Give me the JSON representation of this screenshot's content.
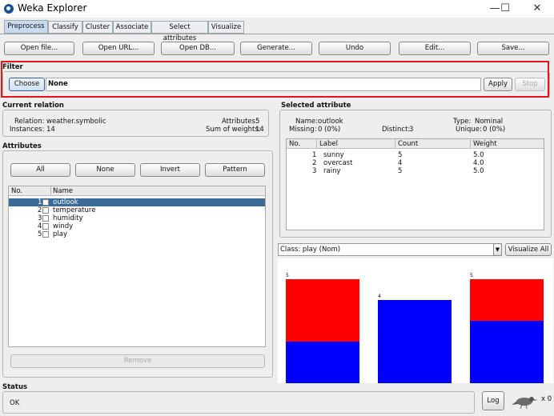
{
  "window": {
    "title": "Weka Explorer",
    "minimize_glyph": "—",
    "maximize_glyph": "☐",
    "close_glyph": "✕"
  },
  "tabs": [
    "Preprocess",
    "Classify",
    "Cluster",
    "Associate",
    "Select attributes",
    "Visualize"
  ],
  "toolbar": {
    "open_file": "Open file...",
    "open_url": "Open URL...",
    "open_db": "Open DB...",
    "generate": "Generate...",
    "undo": "Undo",
    "edit": "Edit...",
    "save": "Save..."
  },
  "filter": {
    "section_label": "Filter",
    "choose_label": "Choose",
    "value": "None",
    "apply_label": "Apply",
    "stop_label": "Stop"
  },
  "current_relation": {
    "section_label": "Current relation",
    "relation_label": "Relation:",
    "relation_value": "weather.symbolic",
    "instances_label": "Instances:",
    "instances_value": "14",
    "attributes_label": "Attributes:",
    "attributes_value": "5",
    "weights_label": "Sum of weights:",
    "weights_value": "14"
  },
  "attributes": {
    "section_label": "Attributes",
    "buttons": {
      "all": "All",
      "none": "None",
      "invert": "Invert",
      "pattern": "Pattern"
    },
    "col_no": "No.",
    "col_name": "Name",
    "rows": [
      {
        "no": "1",
        "name": "outlook"
      },
      {
        "no": "2",
        "name": "temperature"
      },
      {
        "no": "3",
        "name": "humidity"
      },
      {
        "no": "4",
        "name": "windy"
      },
      {
        "no": "5",
        "name": "play"
      }
    ],
    "remove_label": "Remove"
  },
  "selected_attribute": {
    "section_label": "Selected attribute",
    "name_label": "Name:",
    "name_value": "outlook",
    "type_label": "Type:",
    "type_value": "Nominal",
    "missing_label": "Missing:",
    "missing_value": "0 (0%)",
    "distinct_label": "Distinct:",
    "distinct_value": "3",
    "unique_label": "Unique:",
    "unique_value": "0 (0%)",
    "columns": [
      "No.",
      "Label",
      "Count",
      "Weight"
    ],
    "rows": [
      {
        "no": "1",
        "label": "sunny",
        "count": "5",
        "weight": "5.0"
      },
      {
        "no": "2",
        "label": "overcast",
        "count": "4",
        "weight": "4.0"
      },
      {
        "no": "3",
        "label": "rainy",
        "count": "5",
        "weight": "5.0"
      }
    ]
  },
  "class_selector": {
    "value": "Class: play (Nom)",
    "visualize_all": "Visualize All"
  },
  "chart_data": {
    "type": "bar",
    "categories": [
      "sunny",
      "overcast",
      "rainy"
    ],
    "totals": [
      5,
      4,
      5
    ],
    "series": [
      {
        "color": "#ff0000",
        "values": [
          3,
          0,
          2
        ]
      },
      {
        "color": "#0000ff",
        "values": [
          2,
          4,
          3
        ]
      }
    ],
    "data_labels": [
      "5",
      "4",
      "5"
    ]
  },
  "status": {
    "section_label": "Status",
    "text": "OK",
    "log_label": "Log",
    "count": "x 0"
  }
}
